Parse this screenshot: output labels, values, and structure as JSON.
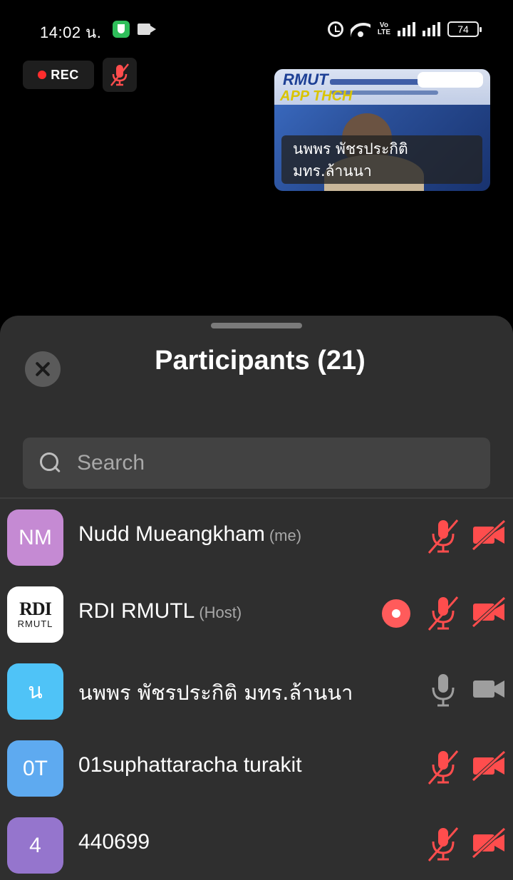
{
  "status_bar": {
    "time": "14:02 น.",
    "volte": "Vo\nLTE",
    "battery": "74"
  },
  "meeting": {
    "rec_label": "REC",
    "video_tile": {
      "logo_line1": "RMUT",
      "logo_line2": "APP THCH",
      "name_line1": "นพพร พัชรประกิติ",
      "name_line2": "มทร.ล้านนา"
    }
  },
  "panel": {
    "title": "Participants (21)",
    "search_placeholder": "Search"
  },
  "participants": [
    {
      "initials": "NM",
      "name": "Nudd Mueangkham",
      "tag": "(me)",
      "avatar_color": "#c58ad3",
      "mic": "muted",
      "camera": "off",
      "recording": false
    },
    {
      "initials": "",
      "logo_text": "RMUTL",
      "name": "RDI RMUTL",
      "tag": "(Host)",
      "avatar_color": "#ffffff",
      "mic": "muted",
      "camera": "off",
      "recording": true
    },
    {
      "initials": "น",
      "name": "นพพร พัชรประกิติ มทร.ล้านนา",
      "tag": "",
      "avatar_color": "#4fc3f7",
      "mic": "on",
      "camera": "on",
      "recording": false
    },
    {
      "initials": "0T",
      "name": "01suphattaracha turakit",
      "tag": "",
      "avatar_color": "#5eaaf0",
      "mic": "muted",
      "camera": "off",
      "recording": false
    },
    {
      "initials": "4",
      "name": "440699",
      "tag": "",
      "avatar_color": "#9575cd",
      "mic": "muted",
      "camera": "off",
      "recording": false
    }
  ],
  "colors": {
    "sheet_bg": "#2f2f2f",
    "muted_red": "#ff4d4d",
    "icon_gray": "#9e9e9e"
  }
}
